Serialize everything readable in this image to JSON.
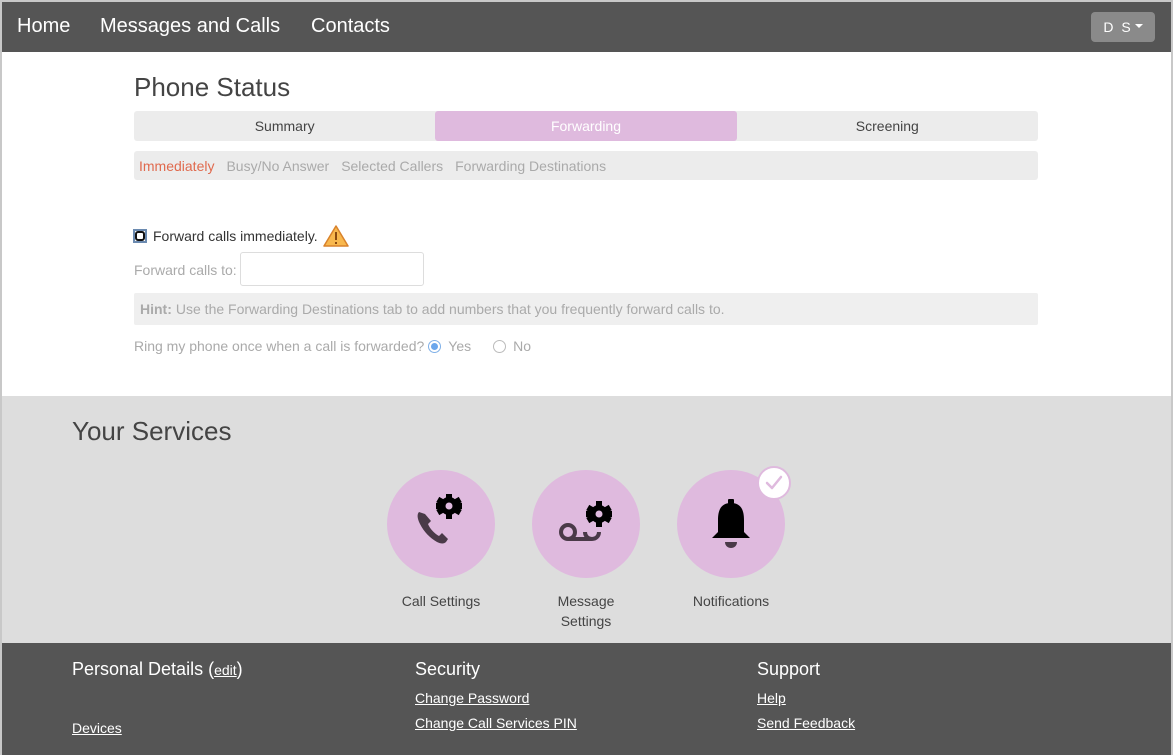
{
  "nav": {
    "links": [
      {
        "label": "Home"
      },
      {
        "label": "Messages and Calls"
      },
      {
        "label": "Contacts"
      }
    ],
    "user_initials": "D S"
  },
  "phone_status": {
    "title": "Phone Status",
    "tabs": [
      {
        "label": "Summary",
        "active": false
      },
      {
        "label": "Forwarding",
        "active": true
      },
      {
        "label": "Screening",
        "active": false
      }
    ],
    "subtabs": [
      {
        "label": "Immediately",
        "active": true
      },
      {
        "label": "Busy/No Answer",
        "active": false
      },
      {
        "label": "Selected Callers",
        "active": false
      },
      {
        "label": "Forwarding Destinations",
        "active": false
      }
    ],
    "forward_immediately": {
      "label": "Forward calls immediately.",
      "checked": false,
      "warning_icon": "warning-triangle-icon"
    },
    "forward_to": {
      "label": "Forward calls to:",
      "value": "",
      "placeholder": ""
    },
    "hint": {
      "prefix": "Hint:",
      "text": "Use the Forwarding Destinations tab to add numbers that you frequently forward calls to."
    },
    "ring_once": {
      "question": "Ring my phone once when a call is forwarded?",
      "options": [
        {
          "label": "Yes",
          "selected": true
        },
        {
          "label": "No",
          "selected": false
        }
      ]
    }
  },
  "services": {
    "title": "Your Services",
    "items": [
      {
        "label": "Call Settings",
        "icon": "phone-gear-icon",
        "enabled": false
      },
      {
        "label": "Message Settings",
        "icon": "voicemail-gear-icon",
        "enabled": false
      },
      {
        "label": "Notifications",
        "icon": "bell-icon",
        "enabled": true
      }
    ]
  },
  "footer": {
    "personal": {
      "title": "Personal Details",
      "edit_label": "edit",
      "links": [
        "Devices"
      ]
    },
    "security": {
      "title": "Security",
      "links": [
        "Change Password",
        "Change Call Services PIN"
      ]
    },
    "support": {
      "title": "Support",
      "links": [
        "Help",
        "Send Feedback"
      ]
    }
  },
  "colors": {
    "accent": "#dfbade",
    "nav_bg": "#555555",
    "active_subtab": "#e06a4e",
    "services_bg": "#dddddd",
    "warning": "#f5a623"
  }
}
